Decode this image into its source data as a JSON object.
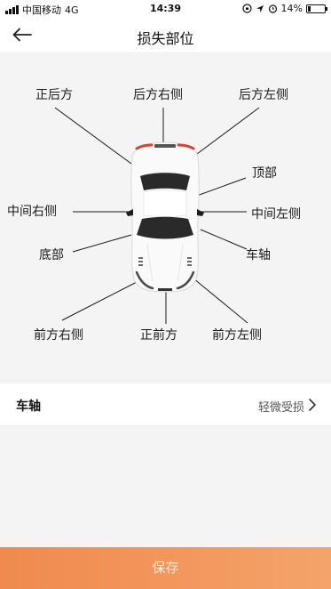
{
  "status_bar": {
    "carrier": "中国移动",
    "network": "4G",
    "time": "14:39",
    "battery": "14%",
    "battery_level": 0.14
  },
  "nav": {
    "title": "损失部位",
    "back_icon": "arrow-left-icon"
  },
  "parts": {
    "rear_center": "正后方",
    "rear_right": "后方右侧",
    "rear_left": "后方左侧",
    "roof": "顶部",
    "middle_right": "中间右侧",
    "middle_left": "中间左侧",
    "bottom": "底部",
    "axle": "车轴",
    "front_right": "前方右侧",
    "front_center": "正前方",
    "front_left": "前方左侧"
  },
  "selection": {
    "part": "车轴",
    "damage": "轻微受损",
    "chevron_icon": "chevron-right-icon"
  },
  "footer": {
    "save_label": "保存",
    "gradient_start": "#f08a4e",
    "gradient_end": "#f4a36a"
  }
}
